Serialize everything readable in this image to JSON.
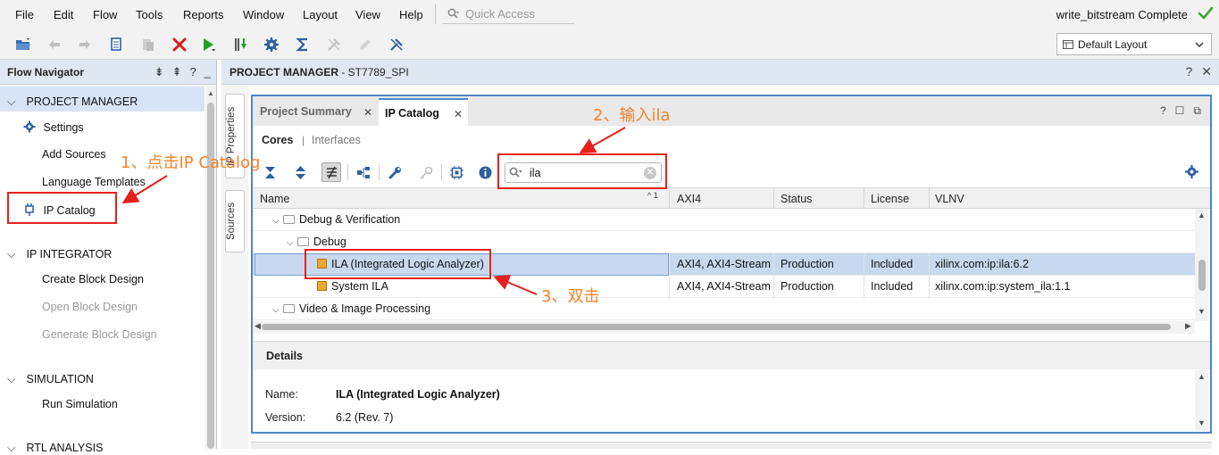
{
  "menubar": {
    "items": [
      "File",
      "Edit",
      "Flow",
      "Tools",
      "Reports",
      "Window",
      "Layout",
      "View",
      "Help"
    ],
    "quick_access_placeholder": "Quick Access",
    "status": "write_bitstream Complete"
  },
  "toolbar": {
    "buttons": [
      "open-project-icon",
      "undo-icon",
      "redo-icon",
      "copy-icon",
      "paste-icon",
      "delete-icon",
      "run-icon",
      "program-download-icon",
      "settings-icon",
      "sigma-icon",
      "disabled-tool-icon",
      "disabled-edit-icon",
      "debug-icon"
    ],
    "layout_label": "Default Layout"
  },
  "flow_navigator": {
    "title": "Flow Navigator",
    "header_icons": [
      "collapse-all",
      "expand-all",
      "help",
      "minimize"
    ],
    "sections": [
      {
        "label": "PROJECT MANAGER",
        "items": [
          "Settings",
          "Add Sources",
          "Language Templates",
          "IP Catalog"
        ]
      },
      {
        "label": "IP INTEGRATOR",
        "items": [
          "Create Block Design",
          "Open Block Design",
          "Generate Block Design"
        ]
      },
      {
        "label": "SIMULATION",
        "items": [
          "Run Simulation"
        ]
      },
      {
        "label": "RTL ANALYSIS",
        "items": []
      }
    ]
  },
  "project_manager": {
    "title": "PROJECT MANAGER",
    "project": " - ST7789_SPI"
  },
  "side_tabs": [
    "IP Properties",
    "Sources"
  ],
  "ip_window": {
    "tabs": [
      "Project Summary",
      "IP Catalog"
    ],
    "subnav": {
      "cores": "Cores",
      "separator": "|",
      "interfaces": "Interfaces"
    },
    "search_value": "ila",
    "columns": [
      "Name",
      "AXI4",
      "Status",
      "License",
      "VLNV"
    ],
    "sort_indicator": "^ 1",
    "rows": [
      {
        "name": "Debug & Verification",
        "axi4": "",
        "status": "",
        "license": "",
        "vlnv": ""
      },
      {
        "name": "Debug",
        "axi4": "",
        "status": "",
        "license": "",
        "vlnv": ""
      },
      {
        "name": "ILA (Integrated Logic Analyzer)",
        "axi4": "AXI4, AXI4-Stream",
        "status": "Production",
        "license": "Included",
        "vlnv": "xilinx.com:ip:ila:6.2"
      },
      {
        "name": "System ILA",
        "axi4": "AXI4, AXI4-Stream",
        "status": "Production",
        "license": "Included",
        "vlnv": "xilinx.com:ip:system_ila:1.1"
      },
      {
        "name": "Video & Image Processing",
        "axi4": "",
        "status": "",
        "license": "",
        "vlnv": ""
      }
    ],
    "details": {
      "title": "Details",
      "name_label": "Name:",
      "name_value": "ILA (Integrated Logic Analyzer)",
      "version_label": "Version:",
      "version_value": "6.2 (Rev. 7)"
    }
  },
  "annotations": [
    {
      "text": "1、点击IP Catalog"
    },
    {
      "text": "2、输入ila"
    },
    {
      "text": "3、双击"
    }
  ],
  "colors": {
    "annotation_box": "#e8201c",
    "annotation_text": "#f5822a",
    "panel_header": "#dfe7f2",
    "selection": "#c7d8ef",
    "window_border": "#4f86c6"
  }
}
